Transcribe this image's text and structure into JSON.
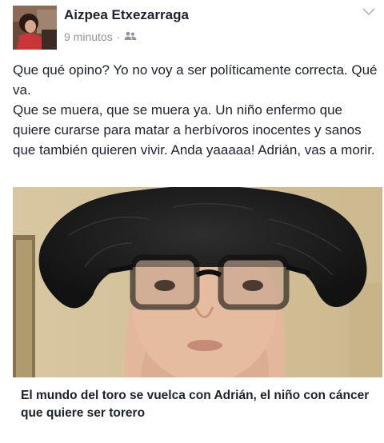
{
  "post": {
    "author": "Aizpea Etxezarraga",
    "time": "9 minutos",
    "separator": "·",
    "audience_icon": "friends-icon",
    "menu_icon": "chevron-down-icon",
    "text_paragraphs": [
      "Que qué opino? Yo no voy a ser políticamente correcta. Qué va.",
      "Que se muera, que se muera ya. Un niño enfermo que quiere curarse para matar a herbívoros inocentes y sanos que también quieren vivir. Anda yaaaaa! Adrián, vas a morir."
    ]
  },
  "link_preview": {
    "title": "El mundo del toro se vuelca con Adrián, el niño con cáncer que quiere ser torero"
  }
}
